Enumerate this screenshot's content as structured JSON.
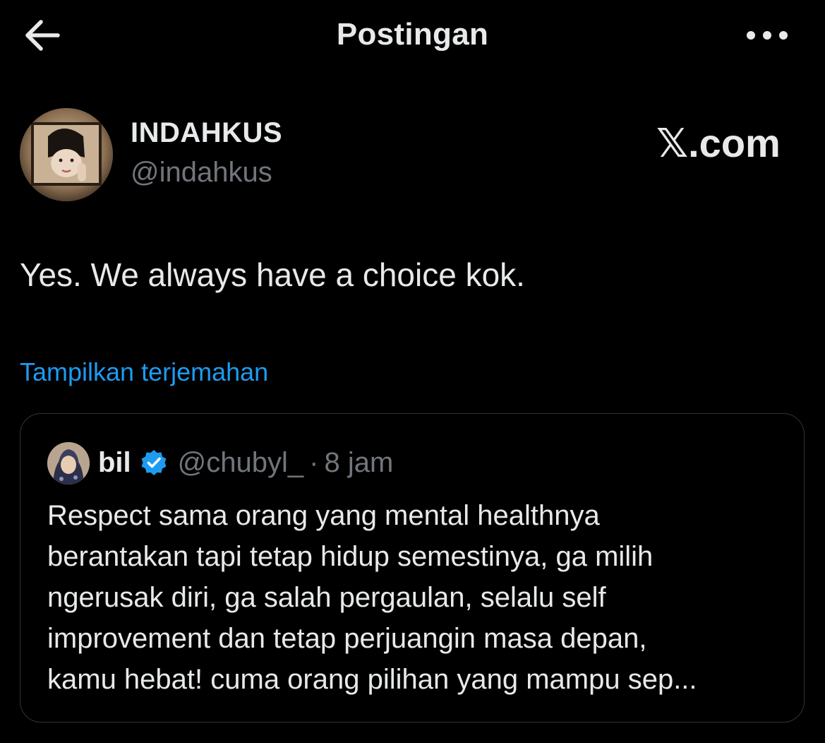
{
  "header": {
    "title": "Postingan",
    "back_icon": "arrow-left-icon",
    "more_icon": "more-horizontal-icon"
  },
  "post": {
    "author_name": "INDAHKUS",
    "author_handle": "@indahkus",
    "watermark": "𝕏.com",
    "text": "Yes. We always have a choice kok.",
    "translate_label": "Tampilkan terjemahan"
  },
  "quoted_post": {
    "name": "bil",
    "handle": "@chubyl_",
    "separator": "·",
    "time": "8 jam",
    "lines": [
      "Respect sama orang yang mental healthnya",
      "berantakan tapi tetap hidup semestinya, ga milih",
      "ngerusak diri, ga salah pergaulan, selalu self",
      "improvement dan tetap perjuangin masa depan,",
      "kamu hebat! cuma orang pilihan yang mampu sep..."
    ]
  },
  "colors": {
    "background": "#000000",
    "text_primary": "#e7e9ea",
    "text_secondary": "#71767b",
    "link": "#1d9bf0",
    "border": "#2f3336",
    "verified": "#1d9bf0"
  }
}
